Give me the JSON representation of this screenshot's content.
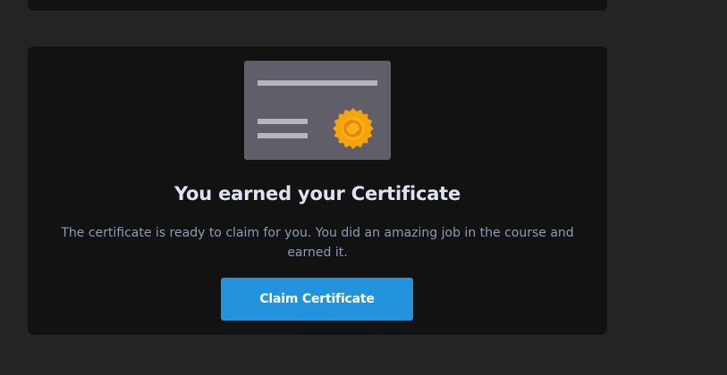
{
  "certificate": {
    "title": "You earned your Certificate",
    "description": "The certificate is ready to claim for you. You did an amazing job in the course and earned it.",
    "claim_label": "Claim Certificate"
  },
  "colors": {
    "page_background": "#232426",
    "card_background": "#121212",
    "accent": "#2493dd",
    "certificate_paper": "#5f5e69",
    "seal": "#f5a50b"
  },
  "icons": {
    "illustration": "certificate-illustration",
    "seal": "certificate-seal-icon"
  }
}
